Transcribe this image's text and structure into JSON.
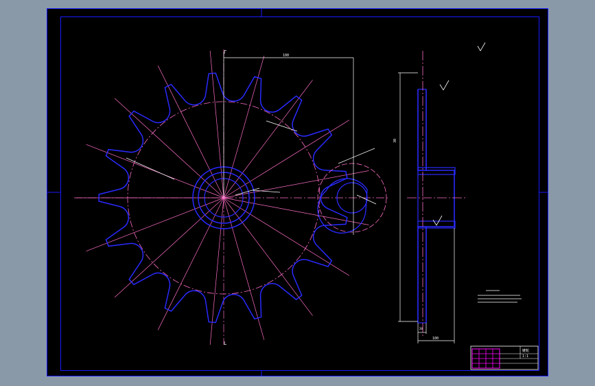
{
  "colors": {
    "viewport_background": "#8a99a8",
    "sheet_background": "#000000",
    "border": "#1a1aff",
    "profile": "#2a2aff",
    "hatch": "#c8c8ff",
    "center_lines": "#ff6ec7",
    "dimensions": "#ffffff",
    "title_block_fill": "#ff00ff"
  },
  "dimensions": {
    "top_width": "100",
    "bottom_width": "100",
    "side_height": "30",
    "hub_note": "20"
  },
  "annotations": {
    "section_mark_top": "Γ",
    "section_mark_bottom": "L"
  },
  "title_block": {
    "part_name": "链轮",
    "scale": "1:1"
  }
}
